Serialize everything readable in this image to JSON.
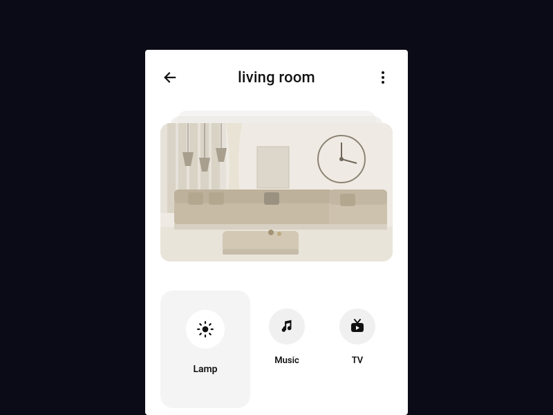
{
  "header": {
    "title": "living room"
  },
  "controls": {
    "primary": {
      "label": "Lamp",
      "icon": "sun-icon"
    },
    "others": [
      {
        "label": "Music",
        "icon": "music-note-icon"
      },
      {
        "label": "TV",
        "icon": "tv-icon"
      }
    ]
  },
  "colors": {
    "background": "#0a0b17",
    "surface": "#ffffff",
    "soft": "#f4f4f4",
    "text": "#111111"
  }
}
